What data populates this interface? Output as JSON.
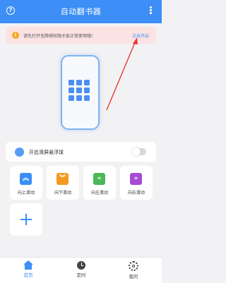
{
  "app_bar": {
    "title": "自动翻书器",
    "help_glyph": "?"
  },
  "notice": {
    "warn_glyph": "!",
    "text": "请先打开无障碍权限才能正常使用哦!",
    "action": "点击开启"
  },
  "floating_ball": {
    "label": "开启滑屏悬浮球",
    "enabled": false
  },
  "scroll_tiles": [
    {
      "label": "向上滑动",
      "icon": "double-chevron-up",
      "glyph": "︽",
      "color": "#3a8ef6"
    },
    {
      "label": "向下滑动",
      "icon": "double-chevron-down",
      "glyph": "︾",
      "color": "#f39a1e"
    },
    {
      "label": "向左滑动",
      "icon": "double-chevron-left",
      "glyph": "«",
      "color": "#4cb85a"
    },
    {
      "label": "向右滑动",
      "icon": "double-chevron-right",
      "glyph": "»",
      "color": "#a64ad6"
    }
  ],
  "bottom_nav": {
    "items": [
      {
        "label": "首页",
        "icon": "home-icon",
        "color": "#3d8ef6",
        "active": true
      },
      {
        "label": "定时",
        "icon": "clock-icon",
        "color": "#444444",
        "active": false
      },
      {
        "label": "我的",
        "icon": "gear-icon",
        "color": "#444444",
        "active": false
      }
    ]
  },
  "colors": {
    "primary": "#3d8ef6",
    "notice_bg": "#fbe3e4",
    "warning": "#f5a623",
    "annotation_arrow": "#e53935"
  }
}
